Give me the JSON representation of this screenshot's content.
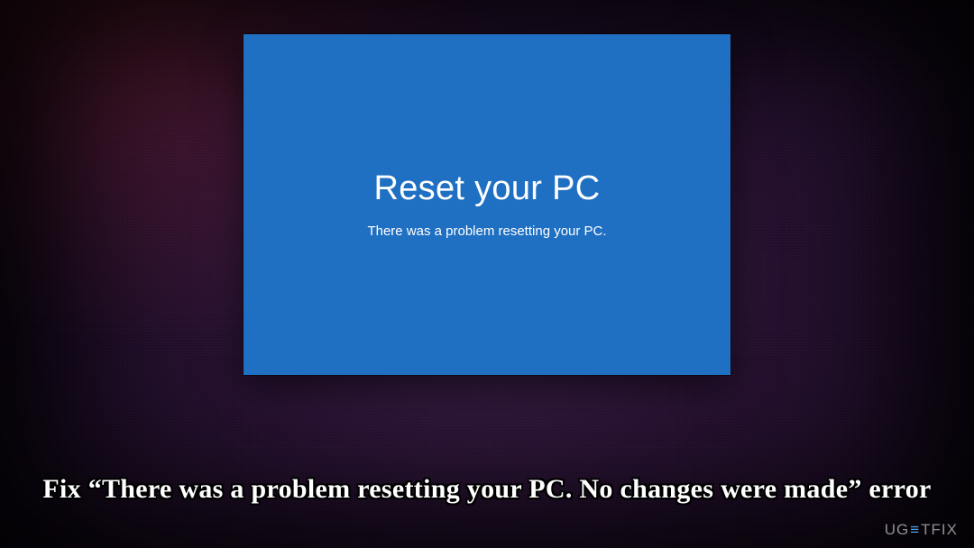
{
  "blue_window": {
    "title": "Reset your PC",
    "message": "There was a problem resetting your PC."
  },
  "caption": "Fix “There was a problem resetting your PC. No changes were made” error",
  "watermark": {
    "pre": "UG",
    "mid": "≡",
    "post": "TFIX"
  }
}
